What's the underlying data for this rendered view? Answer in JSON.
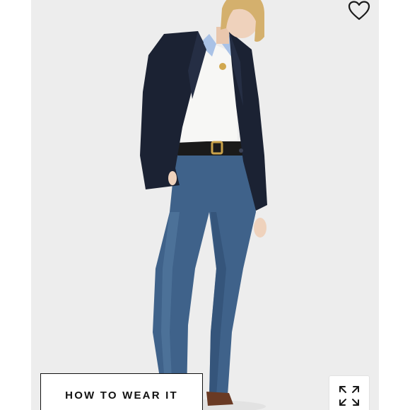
{
  "product_image": {
    "alt": "",
    "background_color": "#ececec"
  },
  "actions": {
    "favorite_icon": "heart-outline-icon",
    "how_to_wear_label": "HOW TO WEAR IT",
    "expand_icon": "expand-arrows-icon"
  },
  "colors": {
    "button_border": "#111111",
    "button_text": "#111111",
    "blazer": "#1b2233",
    "denim": "#3d5f86"
  }
}
